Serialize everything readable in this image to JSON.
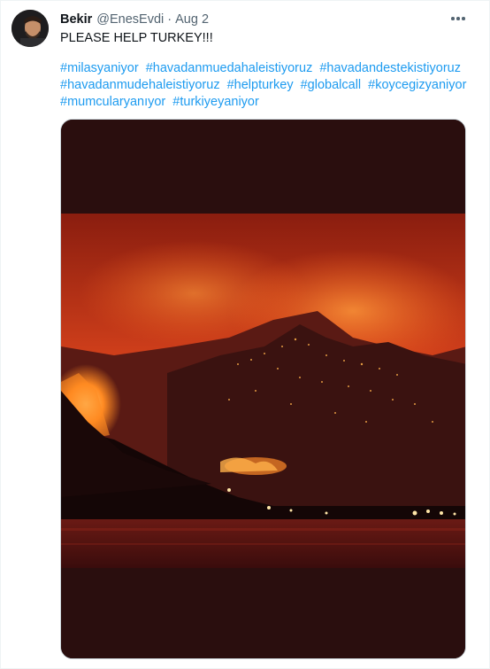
{
  "tweet": {
    "display_name": "Bekir",
    "handle": "@EnesEvdi",
    "separator": "·",
    "date": "Aug 2",
    "text": "PLEASE HELP TURKEY!!!",
    "hashtags": [
      "#milasyaniyor",
      "#havadanmuedahaleistiyoruz",
      "#havadandestekistiyoruz",
      "#havadanmudehaleistiyoruz",
      "#helpturkey",
      "#globalcall",
      "#koycegizyaniyor",
      "#mumcularyanıyor",
      "#turkiyeyaniyor"
    ],
    "media": {
      "icon": "forest-fire-photo",
      "colors": {
        "sky_glow": "#e0451a",
        "fire": "#ff7a1f",
        "water": "#5a1212",
        "frame": "#2a0e0e"
      }
    }
  },
  "colors": {
    "link": "#1d9bf0",
    "secondary_text": "#536471",
    "primary_text": "#0f1419"
  }
}
